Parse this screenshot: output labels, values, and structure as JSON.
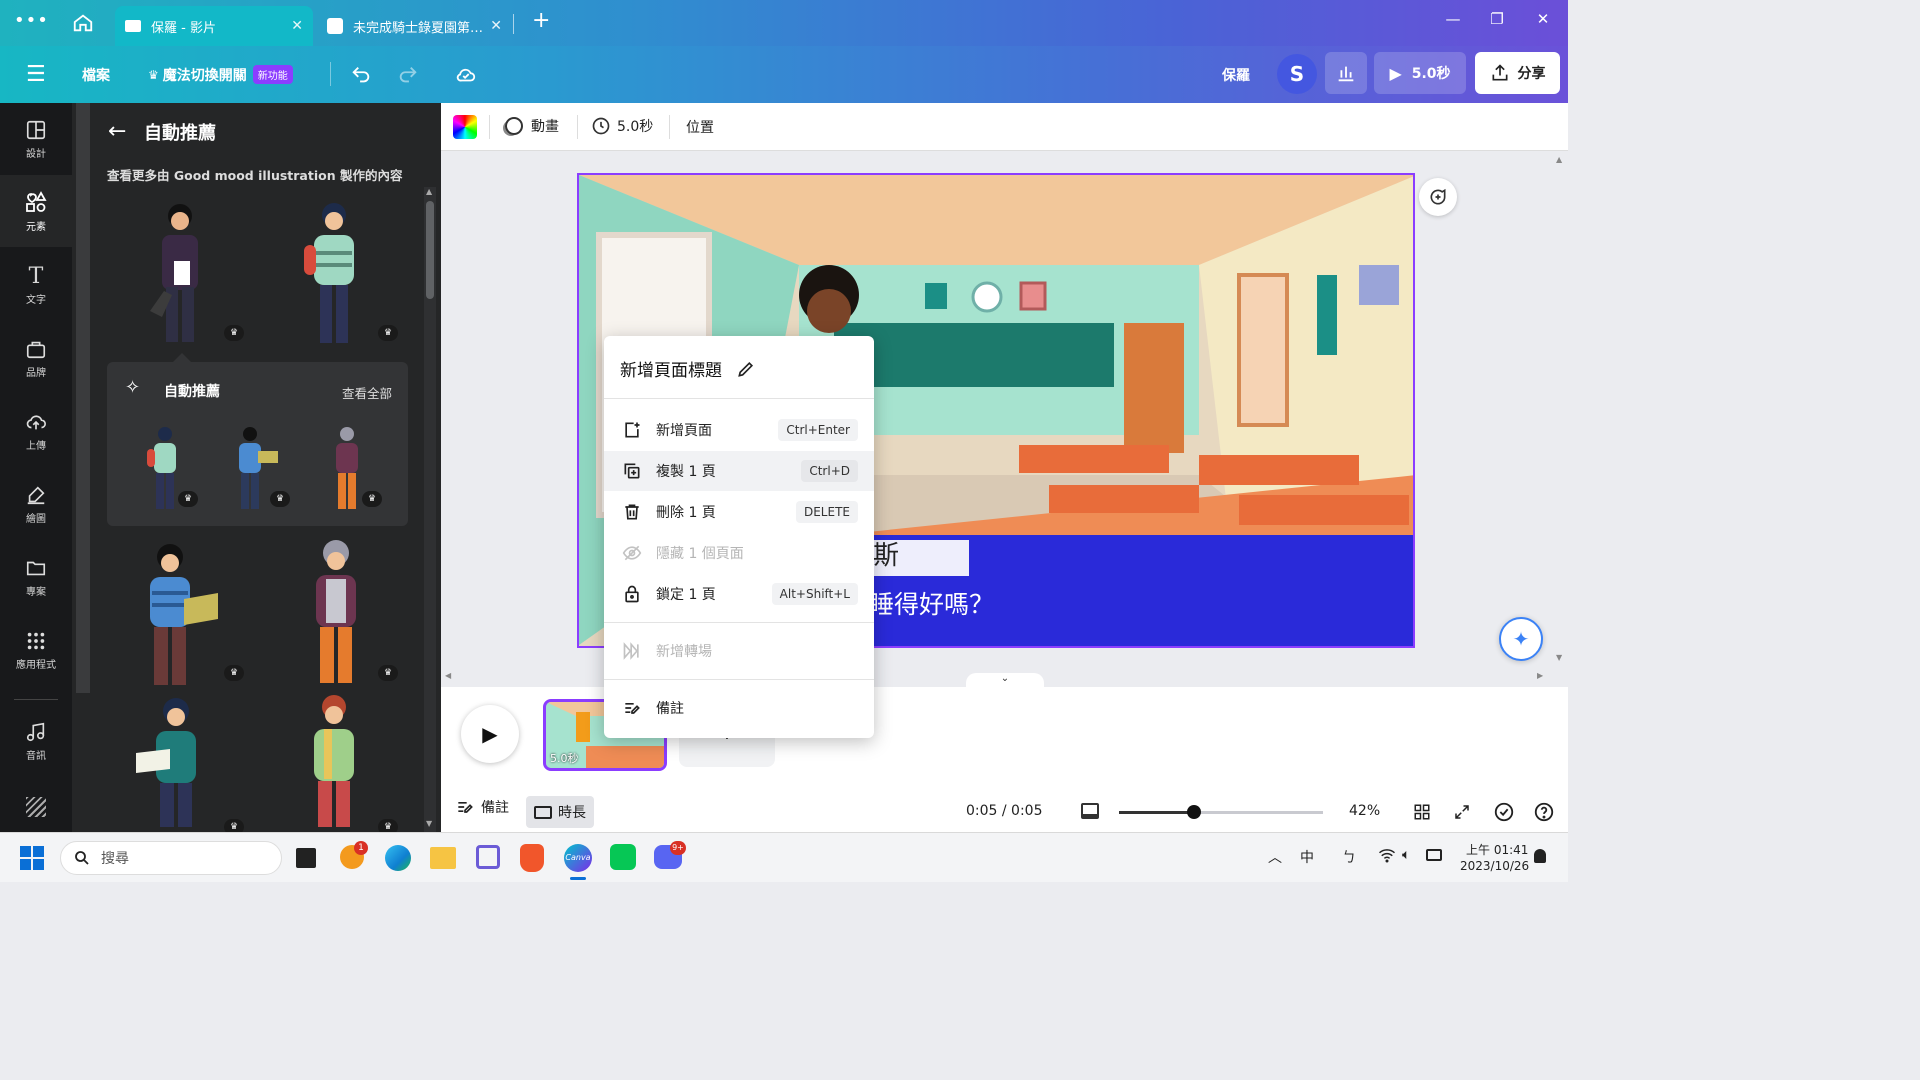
{
  "browser": {
    "tabs": [
      {
        "label": "保羅 - 影片",
        "active": true
      },
      {
        "label": "未完成騎士錄夏園第…",
        "active": false
      }
    ]
  },
  "toolbar": {
    "file_label": "檔案",
    "magic_label": "魔法切換開關",
    "new_badge": "新功能",
    "design_name": "保羅",
    "avatar_letter": "S",
    "play_label": "5.0秒",
    "share_label": "分享"
  },
  "rail": {
    "items": [
      {
        "label": "設計",
        "icon": "layout-icon"
      },
      {
        "label": "元素",
        "icon": "elements-icon"
      },
      {
        "label": "文字",
        "icon": "text-icon"
      },
      {
        "label": "品牌",
        "icon": "brand-icon"
      },
      {
        "label": "上傳",
        "icon": "upload-icon"
      },
      {
        "label": "繪圖",
        "icon": "draw-icon"
      },
      {
        "label": "專案",
        "icon": "folder-icon"
      },
      {
        "label": "應用程式",
        "icon": "apps-icon"
      },
      {
        "label": "音訊",
        "icon": "music-icon"
      }
    ]
  },
  "panel": {
    "title": "自動推薦",
    "subtitle": "查看更多由 Good mood illustration 製作的內容",
    "recommend_title": "自動推薦",
    "see_all": "查看全部",
    "crown": "♛"
  },
  "context_bar": {
    "animate_label": "動畫",
    "duration_label": "5.0秒",
    "position_label": "位置"
  },
  "canvas": {
    "caption_top": "斯",
    "caption_bottom": "睡得好嗎？"
  },
  "context_menu": {
    "title": "新增頁面標題",
    "items": [
      {
        "label": "新增頁面",
        "shortcut": "Ctrl+Enter",
        "disabled": false
      },
      {
        "label": "複製 1 頁",
        "shortcut": "Ctrl+D",
        "disabled": false
      },
      {
        "label": "刪除 1 頁",
        "shortcut": "DELETE",
        "disabled": false
      },
      {
        "label": "隱藏 1 個頁面",
        "shortcut": "",
        "disabled": true
      },
      {
        "label": "鎖定 1 頁",
        "shortcut": "Alt+Shift+L",
        "disabled": false
      },
      {
        "label": "新增轉場",
        "shortcut": "",
        "disabled": true
      },
      {
        "label": "備註",
        "shortcut": "",
        "disabled": false
      }
    ]
  },
  "timeline": {
    "page_duration": "5.0秒",
    "add_page": "+",
    "notes_label": "備註",
    "duration_label": "時長",
    "time": "0:05 / 0:05",
    "zoom": "42%"
  },
  "taskbar": {
    "search_placeholder": "搜尋",
    "notif_count": "1",
    "discord_badge": "9+",
    "ime": "中",
    "ime2": "ㄅ",
    "time": "上午 01:41",
    "date": "2023/10/26"
  },
  "colors": {
    "accent": "#8b3dff",
    "selection": "#8b3dff",
    "canva_teal": "#00c4cc"
  }
}
